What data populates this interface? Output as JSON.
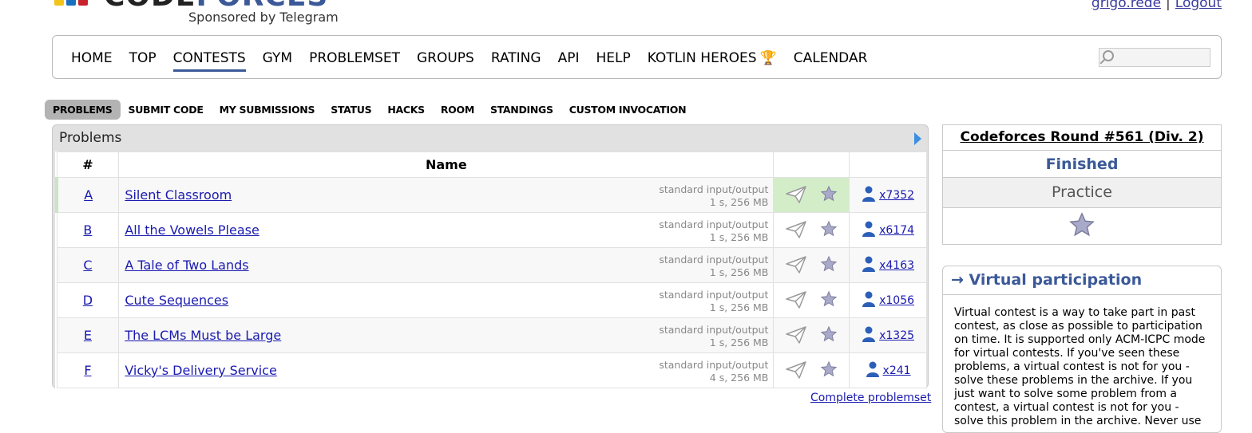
{
  "header": {
    "logo_dark": "CODE",
    "logo_blue": "FORCES",
    "sponsor": "Sponsored by Telegram",
    "user": "grigo.rede",
    "separator": "|",
    "logout": "Logout",
    "logo_colors": [
      "#f2c41a",
      "#1a6fbf",
      "#c8222a"
    ]
  },
  "menu": {
    "items": [
      "HOME",
      "TOP",
      "CONTESTS",
      "GYM",
      "PROBLEMSET",
      "GROUPS",
      "RATING",
      "API",
      "HELP",
      "KOTLIN HEROES",
      "CALENDAR"
    ],
    "active": "CONTESTS",
    "trophy_icon": "trophy-icon"
  },
  "submenu": {
    "items": [
      "PROBLEMS",
      "SUBMIT CODE",
      "MY SUBMISSIONS",
      "STATUS",
      "HACKS",
      "ROOM",
      "STANDINGS",
      "CUSTOM INVOCATION"
    ],
    "current": "PROBLEMS"
  },
  "problems": {
    "caption": "Problems",
    "col_index": "#",
    "col_name": "Name",
    "rows": [
      {
        "index": "A",
        "name": "Silent Classroom",
        "io": "standard input/output",
        "limits": "1 s, 256 MB",
        "solved": "x7352",
        "accepted": true
      },
      {
        "index": "B",
        "name": "All the Vowels Please",
        "io": "standard input/output",
        "limits": "1 s, 256 MB",
        "solved": "x6174",
        "accepted": false
      },
      {
        "index": "C",
        "name": "A Tale of Two Lands",
        "io": "standard input/output",
        "limits": "1 s, 256 MB",
        "solved": "x4163",
        "accepted": false
      },
      {
        "index": "D",
        "name": "Cute Sequences",
        "io": "standard input/output",
        "limits": "1 s, 256 MB",
        "solved": "x1056",
        "accepted": false
      },
      {
        "index": "E",
        "name": "The LCMs Must be Large",
        "io": "standard input/output",
        "limits": "1 s, 256 MB",
        "solved": "x1325",
        "accepted": false
      },
      {
        "index": "F",
        "name": "Vicky's Delivery Service",
        "io": "standard input/output",
        "limits": "4 s, 256 MB",
        "solved": "x241",
        "accepted": false
      }
    ],
    "complete_link": "Complete problemset"
  },
  "sidebar": {
    "contest_title": "Codeforces Round #561 (Div. 2)",
    "status": "Finished",
    "practice": "Practice",
    "virtual_title": "→ Virtual participation",
    "virtual_text": "Virtual contest is a way to take part in past contest, as close as possible to participation on time. It is supported only ACM-ICPC mode for virtual contests. If you've seen these problems, a virtual contest is not for you - solve these problems in the archive. If you just want to solve some problem from a contest, a virtual contest is not for you - solve this problem in the archive. Never use"
  }
}
